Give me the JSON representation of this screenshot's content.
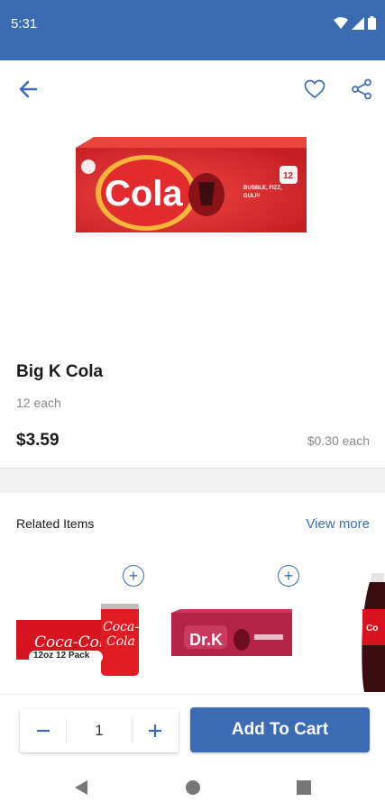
{
  "status_bar": {
    "time": "5:31"
  },
  "product": {
    "name": "Big K Cola",
    "count": "12 each",
    "price": "$3.59",
    "unit_price": "$0.30 each",
    "box_brand_text": "Cola",
    "box_tagline": "BUBBLE, FIZZ, GULP!",
    "box_pack": "12"
  },
  "related": {
    "title": "Related Items",
    "view_more": "View more",
    "items": [
      {
        "name": "Coca-Cola",
        "tag": "12oz 12 Pack"
      },
      {
        "name": "Dr.K"
      },
      {
        "name": "Cola bottle"
      }
    ]
  },
  "cart": {
    "quantity": "1",
    "add_label": "Add To Cart"
  },
  "colors": {
    "accent": "#3b6cb3",
    "brand_red": "#d9282f"
  }
}
